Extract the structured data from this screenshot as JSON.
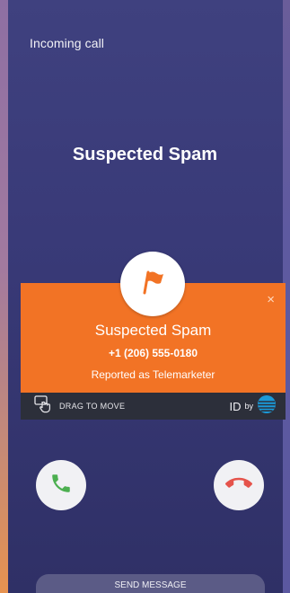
{
  "status": {
    "label": "Incoming call"
  },
  "caller": {
    "title": "Suspected Spam"
  },
  "spam_card": {
    "title": "Suspected Spam",
    "number": "+1 (206) 555-0180",
    "reason": "Reported as Telemarketer",
    "close_label": "×",
    "drag_label": "DRAG TO MOVE",
    "id_label": "ID",
    "by_label": "by"
  },
  "actions": {
    "send_message_label": "SEND MESSAGE"
  },
  "colors": {
    "accent_orange": "#f27325",
    "answer_green": "#4caf50",
    "decline_red": "#e5534b",
    "att_blue": "#1a9ad9"
  },
  "icons": {
    "flag": "flag-icon",
    "answer": "phone-answer-icon",
    "decline": "phone-decline-icon",
    "drag": "drag-hand-icon",
    "provider": "att-globe-icon",
    "close": "close-icon"
  }
}
